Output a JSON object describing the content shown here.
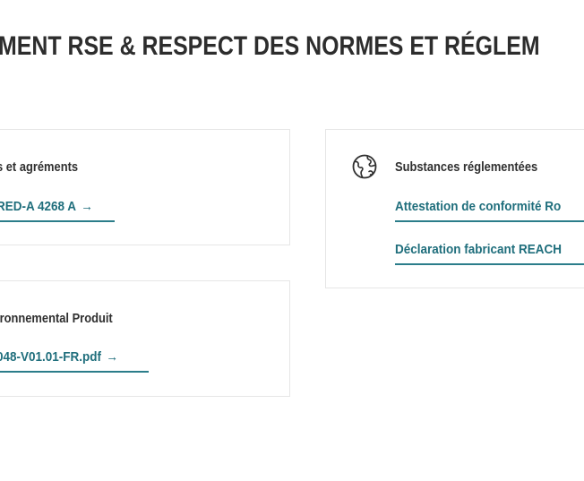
{
  "section": {
    "heading": "MENT RSE & RESPECT DES NORMES ET RÉGLEM"
  },
  "cards": {
    "agrements": {
      "title": "s et agréments",
      "link_text": "RED-A 4268 A",
      "arrow": "→"
    },
    "profil": {
      "title": "ironnemental Produit",
      "link_text": "048-V01.01-FR.pdf",
      "arrow": "→"
    },
    "substances": {
      "icon": "globe-icon",
      "title": "Substances réglementées",
      "links": [
        {
          "text": "Attestation de conformité Ro"
        },
        {
          "text": "Déclaration fabricant REACH"
        }
      ]
    }
  },
  "colors": {
    "heading": "#2d2d2d",
    "link": "#1f6e7c",
    "underline": "#2b7d8a",
    "card_border": "#e6e6e6"
  }
}
